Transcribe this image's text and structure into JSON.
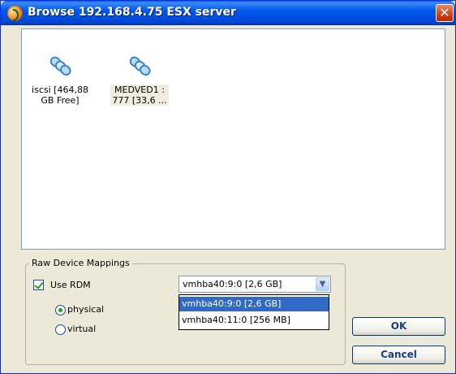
{
  "window": {
    "title": "Browse 192.168.4.75 ESX server",
    "close_label": "✕"
  },
  "datastores": [
    {
      "line1": "iscsi  [464,88",
      "line2": "GB Free]",
      "icon": "datastore-icon"
    },
    {
      "line1": "MEDVED1 :",
      "line2": "777  [33,6 ...",
      "icon": "datastore-icon"
    }
  ],
  "rdm": {
    "group_title": "Raw Device Mappings",
    "use_rdm_label": "Use RDM",
    "use_rdm_checked": true,
    "physical_label": "physical",
    "virtual_label": "virtual",
    "selected_mode": "physical",
    "select_value": "vmhba40:9:0 [2,6 GB]",
    "options": [
      "vmhba40:9:0 [2,6 GB]",
      "vmhba40:11:0 [256 MB]"
    ]
  },
  "buttons": {
    "ok": "OK",
    "cancel": "Cancel"
  },
  "colors": {
    "title_bar": "#0058ee",
    "selection": "#316ac5",
    "dialog_bg": "#ece9d8"
  }
}
